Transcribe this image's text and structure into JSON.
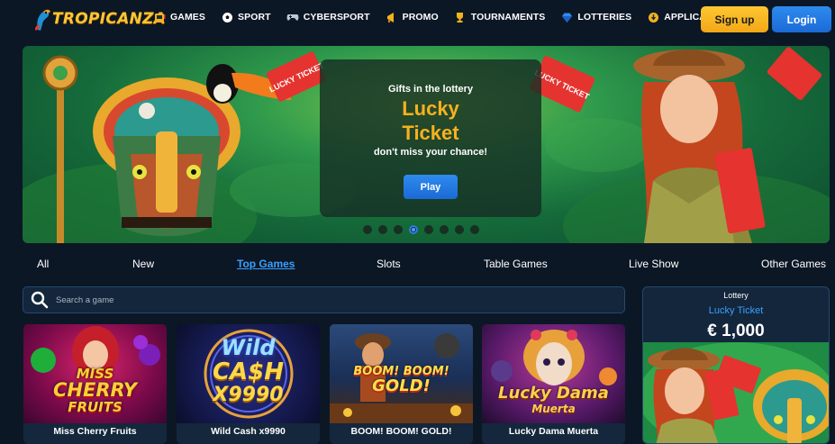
{
  "brand": {
    "name": "TROPICANZA",
    "accent": "#f7c733"
  },
  "nav": {
    "items": [
      {
        "label": "GAMES",
        "icon": "slot-machine-icon"
      },
      {
        "label": "SPORT",
        "icon": "soccer-ball-icon"
      },
      {
        "label": "CYBERSPORT",
        "icon": "gamepad-icon"
      },
      {
        "label": "PROMO",
        "icon": "megaphone-icon"
      },
      {
        "label": "TOURNAMENTS",
        "icon": "trophy-icon"
      },
      {
        "label": "LOTTERIES",
        "icon": "diamond-icon"
      },
      {
        "label": "APPLICATION",
        "icon": "download-icon"
      }
    ],
    "signup_label": "Sign up",
    "login_label": "Login"
  },
  "banner": {
    "subtitle": "Gifts in the lottery",
    "title_line1": "Lucky",
    "title_line2": "Ticket",
    "tagline": "don't miss your chance!",
    "play_label": "Play",
    "ticket_text": "LUCKY TICKET",
    "slides": 8,
    "active_slide": 4
  },
  "categories": [
    {
      "label": "All"
    },
    {
      "label": "New"
    },
    {
      "label": "Top Games",
      "active": true
    },
    {
      "label": "Slots"
    },
    {
      "label": "Table Games"
    },
    {
      "label": "Live Show"
    },
    {
      "label": "Other Games"
    }
  ],
  "search": {
    "placeholder": "Search a game"
  },
  "games": [
    {
      "name": "Miss Cherry Fruits",
      "art_line1": "MISS",
      "art_line2": "CHERRY",
      "art_line3": "FRUITS"
    },
    {
      "name": "Wild Cash x9990",
      "art_line1": "Wild",
      "art_line2": "CA$H",
      "art_line3": "X9990"
    },
    {
      "name": "BOOM! BOOM! GOLD!",
      "art_line1": "BOOM! BOOM!",
      "art_line2": "GOLD!"
    },
    {
      "name": "Lucky Dama Muerta",
      "art_line1": "Lucky Dama",
      "art_line2": "Muerta"
    }
  ],
  "lottery": {
    "label": "Lottery",
    "name": "Lucky Ticket",
    "prize": "€ 1,000"
  }
}
